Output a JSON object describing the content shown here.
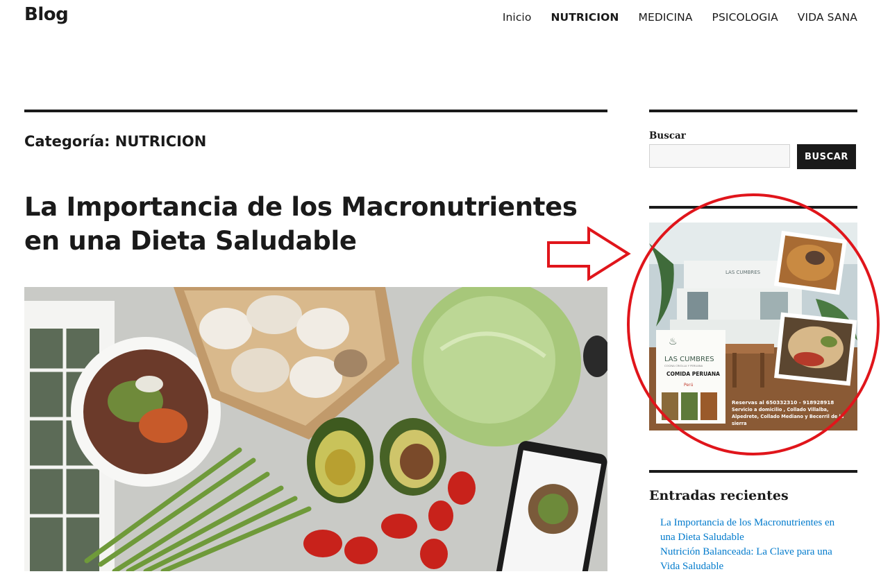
{
  "site": {
    "title": "Blog"
  },
  "nav": {
    "items": [
      {
        "label": "Inicio",
        "current": false
      },
      {
        "label": "NUTRICION",
        "current": true
      },
      {
        "label": "MEDICINA",
        "current": false
      },
      {
        "label": "PSICOLOGIA",
        "current": false
      },
      {
        "label": "VIDA SANA",
        "current": false
      }
    ]
  },
  "archive": {
    "title": "Categoría: NUTRICION"
  },
  "post": {
    "title_line1": "La Importancia de los Macronutrientes",
    "title_line2": "en una Dieta Saludable"
  },
  "search": {
    "label": "Buscar",
    "button": "BUSCAR",
    "value": ""
  },
  "ad": {
    "sign": "LAS CUMBRES",
    "brand": "LAS CUMBRES",
    "tagline": "COMIDA PERUANA",
    "subtag": "COCINA CRIOLLA Y PERUANA",
    "peru": "Perú",
    "info_line1": "Reservas al 650332310 - 918928918",
    "info_line2": "Servicio a domicilio , Collado Villalba,",
    "info_line3": "Alpedrete, Collado Mediano y Becerril de la",
    "info_line4": "sierra"
  },
  "recent": {
    "title": "Entradas recientes",
    "posts": [
      {
        "line1": "La Importancia de los Macronutrientes en",
        "line2": "una Dieta Saludable"
      },
      {
        "line1": "Nutrición Balanceada: La Clave para una",
        "line2": "Vida Saludable"
      }
    ]
  },
  "colors": {
    "text": "#1a1a1a",
    "link": "#007acc",
    "annotation": "#e0151b"
  }
}
